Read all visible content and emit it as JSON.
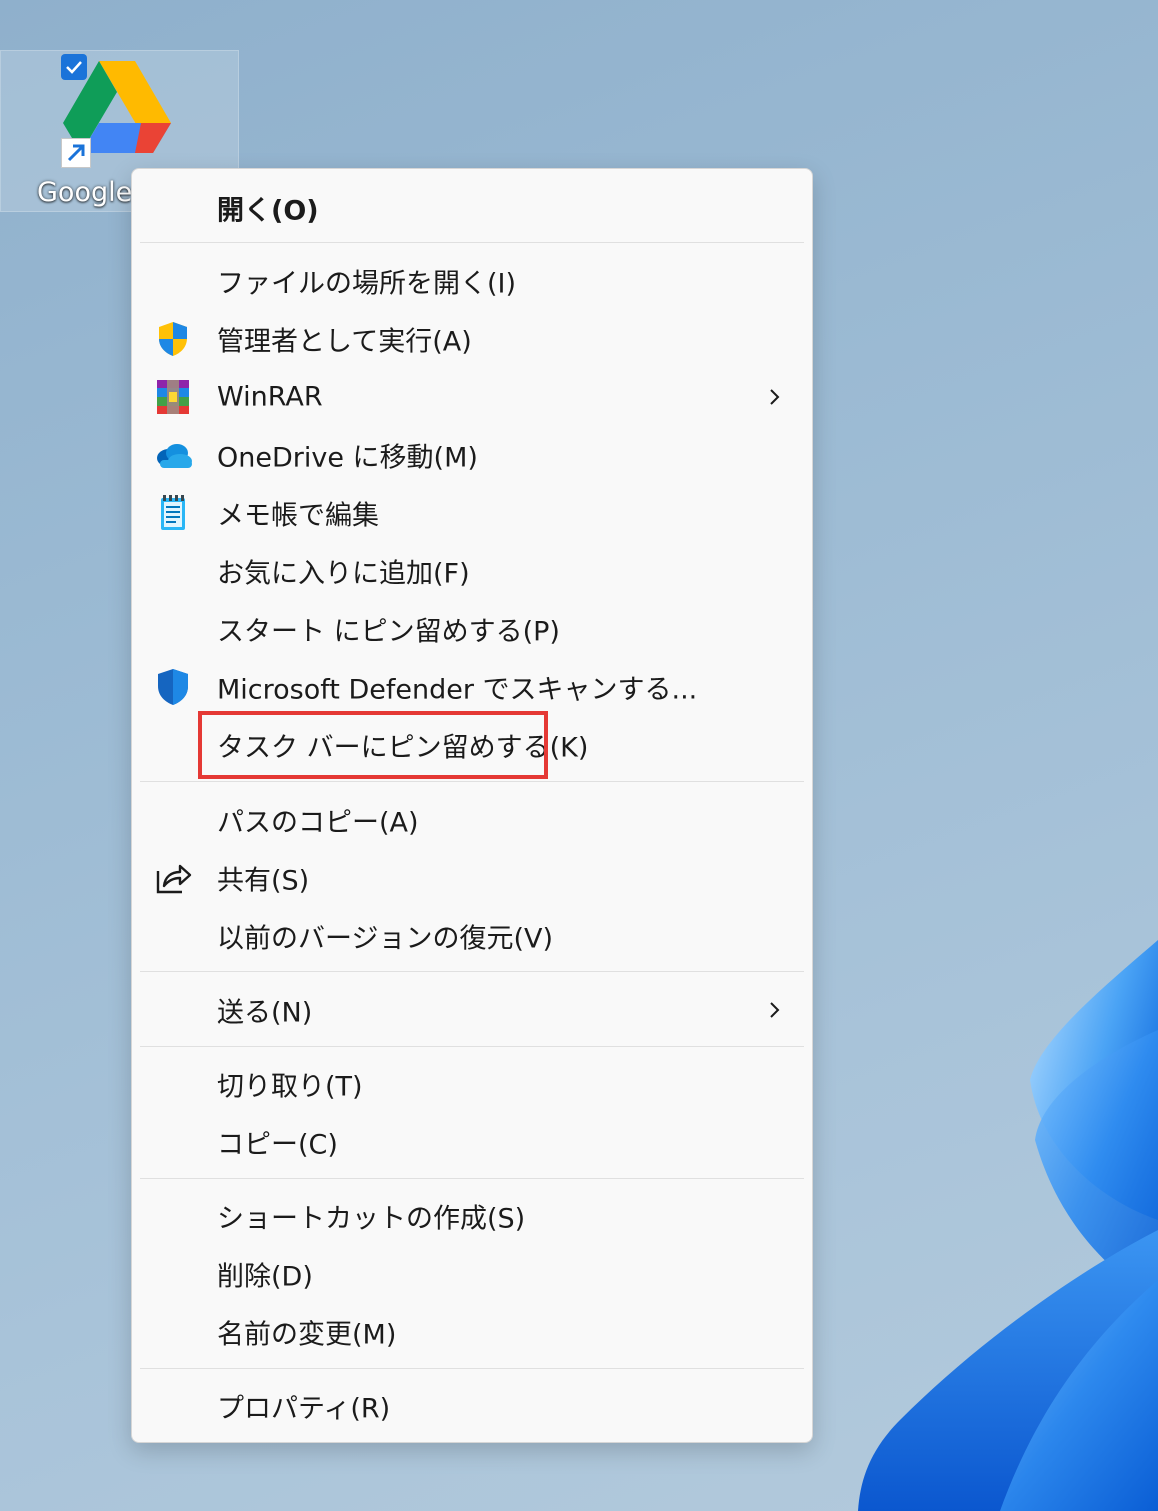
{
  "desktop": {
    "icon_label": "Google",
    "icon": "google-drive-icon"
  },
  "menu": {
    "items": [
      {
        "label": "開く(O)",
        "icon": ""
      },
      {
        "label": "ファイルの場所を開く(I)",
        "icon": ""
      },
      {
        "label": "管理者として実行(A)",
        "icon": "uac-shield-icon"
      },
      {
        "label": "WinRAR",
        "icon": "winrar-icon",
        "submenu": true
      },
      {
        "label": "OneDrive に移動(M)",
        "icon": "onedrive-cloud-icon"
      },
      {
        "label": "メモ帳で編集",
        "icon": "notepad-icon"
      },
      {
        "label": "お気に入りに追加(F)",
        "icon": ""
      },
      {
        "label": "スタート にピン留めする(P)",
        "icon": ""
      },
      {
        "label": "Microsoft Defender でスキャンする...",
        "icon": "defender-shield-icon"
      },
      {
        "label": "タスク バーにピン留めする(K)",
        "icon": ""
      },
      {
        "label": "パスのコピー(A)",
        "icon": ""
      },
      {
        "label": "共有(S)",
        "icon": "share-icon"
      },
      {
        "label": "以前のバージョンの復元(V)",
        "icon": ""
      },
      {
        "label": "送る(N)",
        "icon": "",
        "submenu": true
      },
      {
        "label": "切り取り(T)",
        "icon": ""
      },
      {
        "label": "コピー(C)",
        "icon": ""
      },
      {
        "label": "ショートカットの作成(S)",
        "icon": ""
      },
      {
        "label": "削除(D)",
        "icon": ""
      },
      {
        "label": "名前の変更(M)",
        "icon": ""
      },
      {
        "label": "プロパティ(R)",
        "icon": ""
      }
    ]
  },
  "colors": {
    "highlight": "#e53935",
    "menu_background": "#f9f9f9",
    "accent": "#1a73d9"
  }
}
